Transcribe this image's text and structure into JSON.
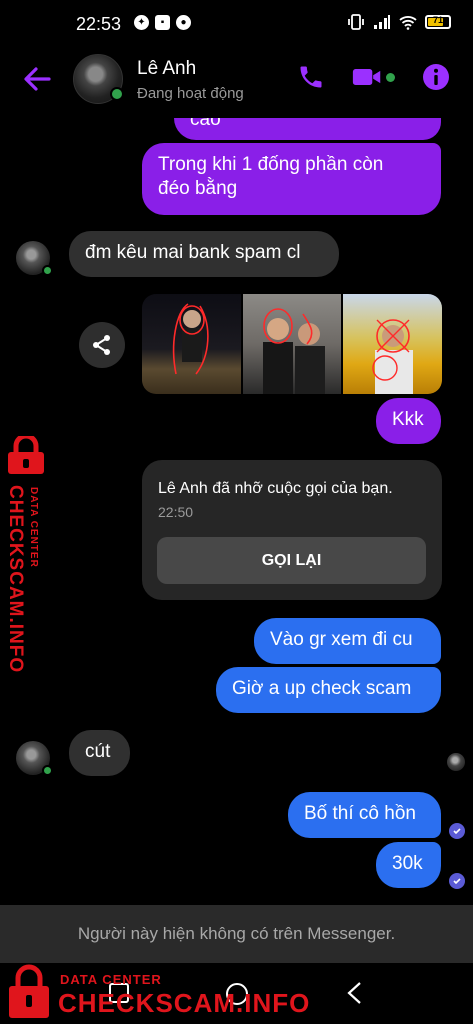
{
  "status_bar": {
    "time": "22:53",
    "battery": "71"
  },
  "header": {
    "name": "Lê Anh",
    "status": "Đang hoạt động"
  },
  "messages": {
    "m0": "cao",
    "m1_line1": "Trong khi 1 đống phần còn",
    "m1_line2": "đéo bằng",
    "m2": "đm kêu mai bank spam cl",
    "m3": "Kkk",
    "m4": "Vào gr xem đi cu",
    "m5": "Giờ a up check scam",
    "m6": "cút",
    "m7": "Bố thí cô hồn",
    "m8": "30k"
  },
  "missed_call": {
    "title": "Lê Anh đã nhỡ cuộc gọi của bạn.",
    "time": "22:50",
    "button": "GỌI LẠI"
  },
  "notice": "Người này hiện không có trên Messenger.",
  "watermark": {
    "small": "DATA CENTER",
    "big": "CHECKSCAM.INFO"
  },
  "colors": {
    "accent": "#8a1fe8",
    "outgoing_blue": "#2b6ff0",
    "incoming_gray": "#303030",
    "watermark_red": "#e0151c",
    "online": "#31a24c"
  },
  "icons": {
    "back": "arrow-left-icon",
    "call": "phone-icon",
    "video": "video-camera-icon",
    "info": "info-icon",
    "share": "share-icon",
    "seen": "check-circle-icon"
  }
}
